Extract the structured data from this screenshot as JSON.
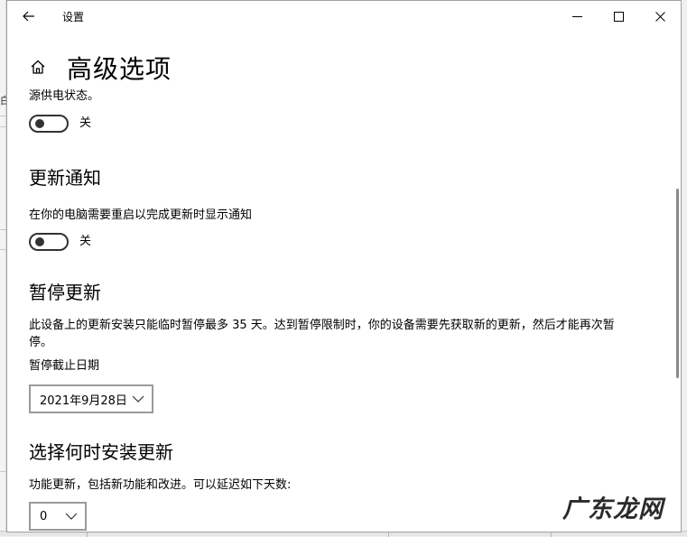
{
  "window": {
    "title": "设置"
  },
  "header": {
    "page_title": "高级选项"
  },
  "sections": {
    "power": {
      "description_tail": "源供电状态。",
      "toggle_state": "关"
    },
    "update_notifications": {
      "heading": "更新通知",
      "description": "在你的电脑需要重启以完成更新时显示通知",
      "toggle_state": "关"
    },
    "pause_updates": {
      "heading": "暂停更新",
      "description_line1": "此设备上的更新安装只能临时暂停最多 35 天。达到暂停限制时，你的设备需要先获取新的更新，然后才能再次暂",
      "description_line2": "停。",
      "date_label": "暂停截止日期",
      "date_value": "2021年9月28日"
    },
    "install_timing": {
      "heading": "选择何时安装更新",
      "feature_label": "功能更新，包括新功能和改进。可以延迟如下天数:",
      "feature_value": "0"
    }
  },
  "background": {
    "left_fragment": "白"
  },
  "watermark": {
    "text": "广东龙网"
  },
  "icons": {
    "back": "back-arrow-icon",
    "home": "home-icon",
    "minimize": "minimize-icon",
    "maximize": "maximize-icon",
    "close": "close-icon",
    "chevron": "chevron-down-icon"
  },
  "colors": {
    "toggle_off": "#333333",
    "dropdown_border": "#9a9a9a",
    "scroll_thumb": "#8a8a8a"
  }
}
